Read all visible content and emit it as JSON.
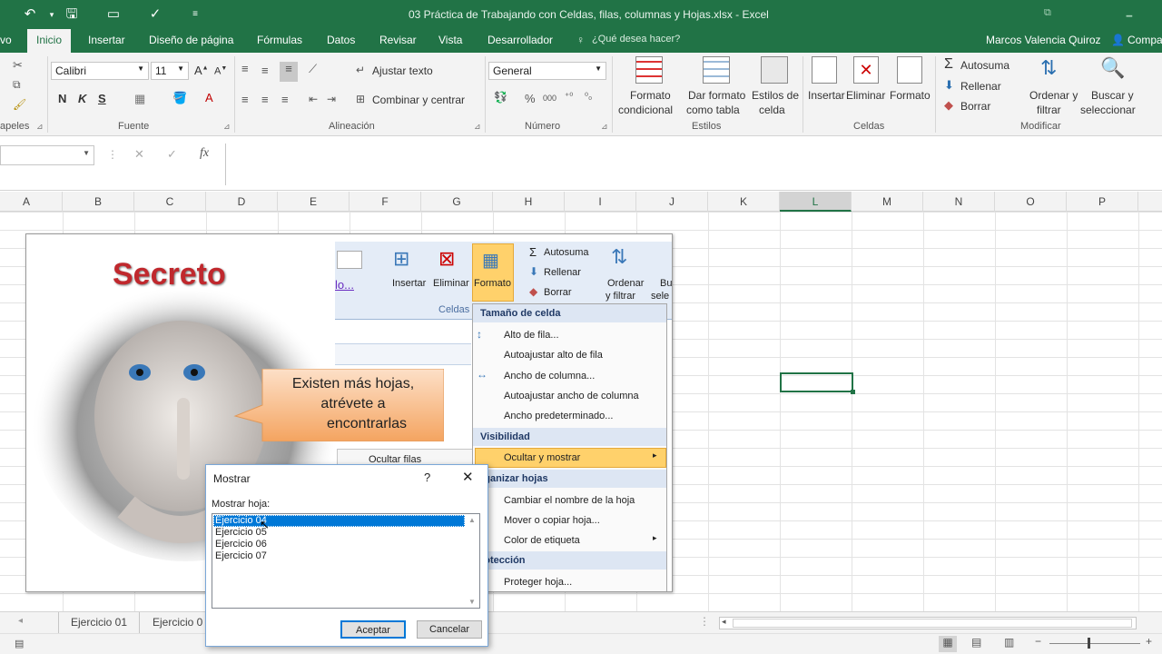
{
  "window": {
    "title": "03 Práctica de Trabajando con Celdas, filas, columnas y Hojas.xlsx - Excel"
  },
  "tabs": [
    {
      "label": "vo"
    },
    {
      "label": "Inicio"
    },
    {
      "label": "Insertar"
    },
    {
      "label": "Diseño de página"
    },
    {
      "label": "Fórmulas"
    },
    {
      "label": "Datos"
    },
    {
      "label": "Revisar"
    },
    {
      "label": "Vista"
    },
    {
      "label": "Desarrollador"
    }
  ],
  "tell_me": "¿Qué desea hacer?",
  "user": "Marcos Valencia Quiroz",
  "share": "Compa",
  "ribbon": {
    "clipboard_group": "apeles",
    "font_name": "Calibri",
    "font_size": "11",
    "bold": "N",
    "italic": "K",
    "underline": "S",
    "font_group": "Fuente",
    "wrap_text": "Ajustar texto",
    "merge_center": "Combinar y centrar",
    "alignment_group": "Alineación",
    "number_format": "General",
    "number_group": "Número",
    "cond_format_1": "Formato",
    "cond_format_2": "condicional",
    "table_format_1": "Dar formato",
    "table_format_2": "como tabla",
    "cell_styles_1": "Estilos de",
    "cell_styles_2": "celda",
    "styles_group": "Estilos",
    "insert": "Insertar",
    "delete": "Eliminar",
    "format": "Formato",
    "cells_group": "Celdas",
    "autosum": "Autosuma",
    "fill": "Rellenar",
    "clear": "Borrar",
    "sort_1": "Ordenar y",
    "sort_2": "filtrar",
    "find_1": "Buscar y",
    "find_2": "seleccionar",
    "modify_group": "Modificar"
  },
  "formula_bar": {
    "fx": "fx"
  },
  "columns": [
    "A",
    "B",
    "C",
    "D",
    "E",
    "F",
    "G",
    "H",
    "I",
    "J",
    "K",
    "L",
    "M",
    "N",
    "O",
    "P"
  ],
  "image_panel": {
    "heading": "Secreto",
    "callout": [
      "Existen más hojas,",
      "atrévete a",
      "encontrarlas"
    ],
    "mini_ribbon": {
      "insert": "Insertar",
      "delete": "Eliminar",
      "format": "Formato",
      "cells": "Celdas",
      "autosum": "Autosuma",
      "fill": "Rellenar",
      "clear": "Borrar",
      "sort_1": "Ordenar",
      "sort_2": "y filtrar",
      "bu_1": "Bu",
      "bu_2": "sele",
      "link_fragment": "lo..."
    },
    "menu": {
      "section_size": "Tamaño de celda",
      "row_height": "Alto de fila...",
      "autofit_row": "Autoajustar alto de fila",
      "col_width": "Ancho de columna...",
      "autofit_col": "Autoajustar ancho de columna",
      "default_width": "Ancho predeterminado...",
      "section_visibility": "Visibilidad",
      "hide_show": "Ocultar y mostrar",
      "section_organize": "rganizar hojas",
      "rename_sheet": "Cambiar el nombre de la hoja",
      "move_copy": "Mover o copiar hoja...",
      "tab_color": "Color de etiqueta",
      "section_protect": "rotección",
      "protect_sheet": "Proteger hoja..."
    },
    "submenu_partial": "Ocultar  filas"
  },
  "dialog": {
    "title": "Mostrar",
    "help": "?",
    "label": "Mostrar hoja:",
    "sheets": [
      "Ejercicio 04",
      "Ejercicio 05",
      "Ejercicio 06",
      "Ejercicio 07"
    ],
    "accept": "Aceptar",
    "cancel": "Cancelar"
  },
  "sheet_tabs": [
    "Ejercicio 01",
    "Ejercicio 0"
  ]
}
